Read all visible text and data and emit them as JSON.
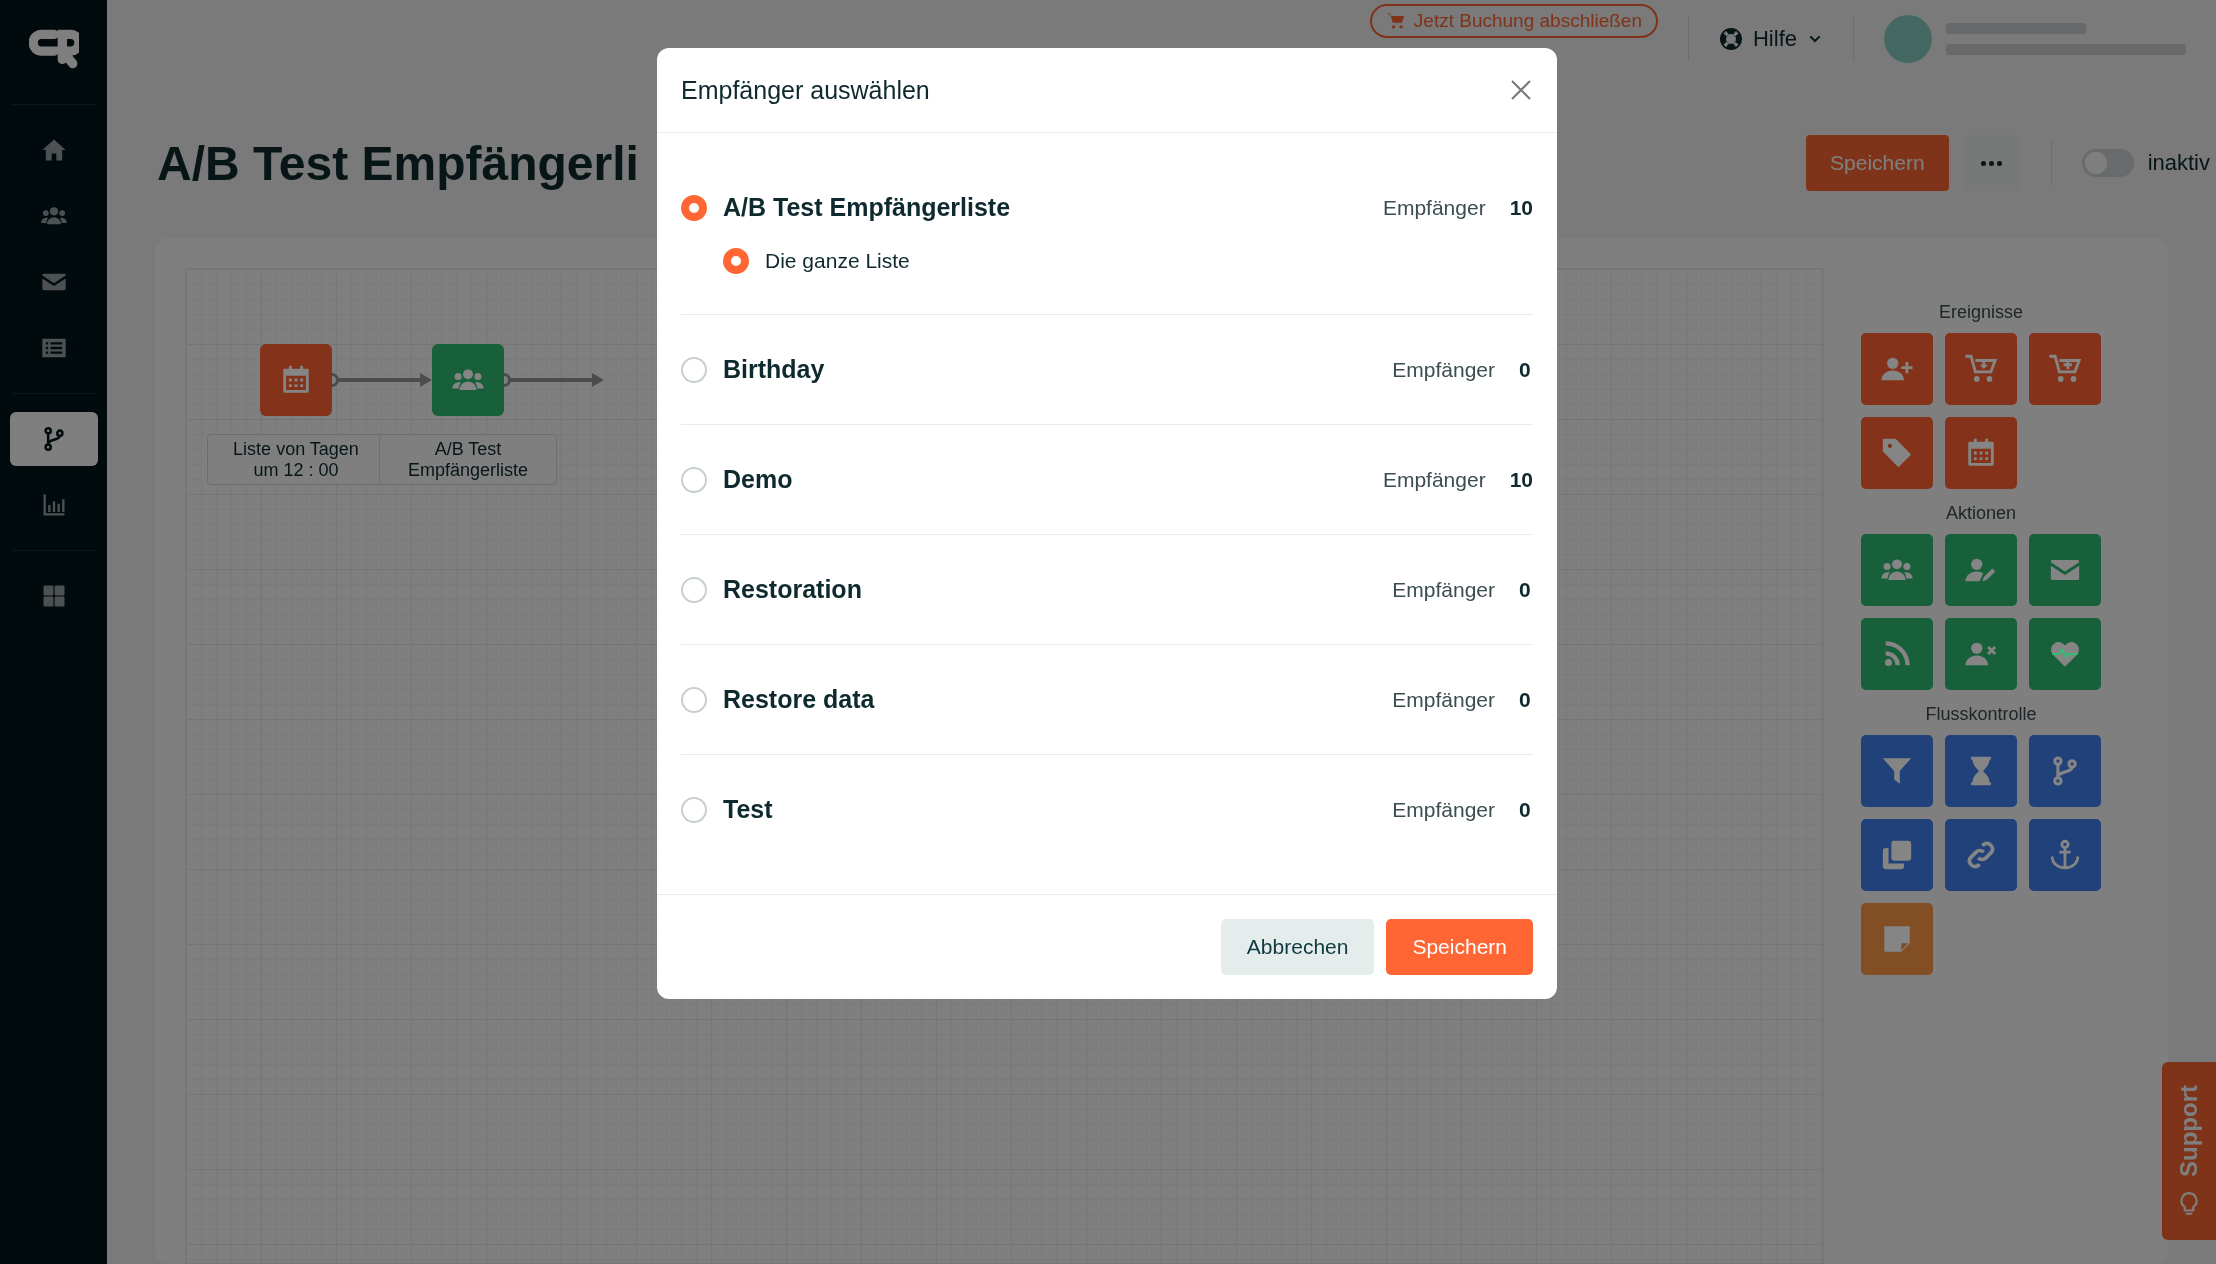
{
  "sidebar": {
    "items": [
      {
        "selected": false
      },
      {
        "selected": false
      },
      {
        "selected": false
      },
      {
        "selected": false
      },
      {
        "selected": true
      },
      {
        "selected": false
      },
      {
        "selected": false
      }
    ]
  },
  "top_bar": {
    "booking_button": "Jetzt Buchung abschließen",
    "help": "Hilfe"
  },
  "header": {
    "title": "A/B Test Empfängerli",
    "save": "Speichern",
    "status": {
      "on": false,
      "label": "inaktiv"
    }
  },
  "canvas": {
    "nodes": [
      {
        "label": "Liste von Tagen\num 12 : 00",
        "color": "#84331a"
      },
      {
        "label": "A/B Test\nEmpfängerliste",
        "color": "#17603a"
      }
    ]
  },
  "palette": [
    {
      "title": "Ereignisse",
      "tiles": [
        {
          "color": "#84331a"
        },
        {
          "color": "#84331a"
        },
        {
          "color": "#84331a"
        },
        {
          "color": "#84331a"
        },
        {
          "color": "#84331a"
        }
      ]
    },
    {
      "title": "Aktionen",
      "tiles": [
        {
          "color": "#17603a"
        },
        {
          "color": "#17603a"
        },
        {
          "color": "#17603a"
        },
        {
          "color": "#17603a"
        },
        {
          "color": "#17603a"
        },
        {
          "color": "#17603a"
        }
      ]
    },
    {
      "title": "Flusskontrolle",
      "tiles": [
        {
          "color": "#20417a"
        },
        {
          "color": "#20417a"
        },
        {
          "color": "#20417a"
        },
        {
          "color": "#20417a"
        },
        {
          "color": "#20417a"
        },
        {
          "color": "#20417a"
        },
        {
          "color": "#824f24"
        }
      ]
    }
  ],
  "support": "Support",
  "modal": {
    "title": "Empfänger auswählen",
    "lists": [
      {
        "name": "A/B Test Empfängerliste",
        "count_label": "Empfänger",
        "count": "10",
        "selected": true,
        "options": [
          {
            "label": "Die ganze Liste",
            "selected": true
          }
        ]
      },
      {
        "name": "Birthday",
        "count_label": "Empfänger",
        "count": "0",
        "selected": false
      },
      {
        "name": "Demo",
        "count_label": "Empfänger",
        "count": "10",
        "selected": false
      },
      {
        "name": "Restoration",
        "count_label": "Empfänger",
        "count": "0",
        "selected": false
      },
      {
        "name": "Restore data",
        "count_label": "Empfänger",
        "count": "0",
        "selected": false
      },
      {
        "name": "Test",
        "count_label": "Empfänger",
        "count": "0",
        "selected": false
      }
    ],
    "cancel": "Abbrechen",
    "save": "Speichern"
  }
}
